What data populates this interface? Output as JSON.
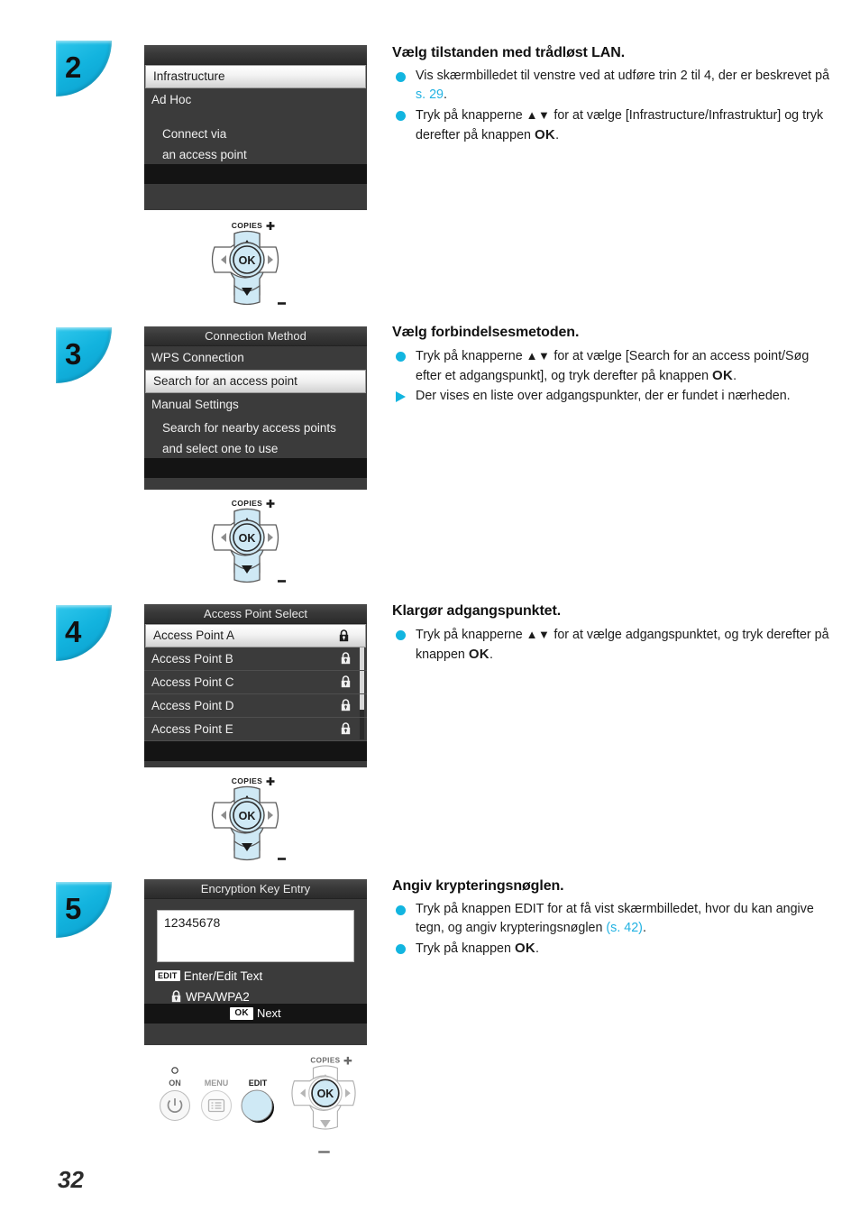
{
  "page": {
    "number": "32"
  },
  "steps": [
    {
      "badge": "2",
      "screen": {
        "title": "",
        "rows": [
          {
            "label": "Infrastructure",
            "selected": true
          },
          {
            "label": "Ad Hoc",
            "selected": false
          }
        ],
        "sublines": [
          "Connect via",
          "an access point"
        ]
      },
      "heading": "Vælg tilstanden med trådløst LAN.",
      "bullets": [
        {
          "type": "dot",
          "parts": [
            {
              "t": "Vis skærmbilledet til venstre ved at udføre trin 2 til 4, der er beskrevet på "
            },
            {
              "t": "s. 29",
              "style": "link"
            },
            {
              "t": "."
            }
          ]
        },
        {
          "type": "dot",
          "parts": [
            {
              "t": "Tryk på knapperne "
            },
            {
              "t": "▲▼",
              "style": "arrows"
            },
            {
              "t": " for at vælge [Infrastructure/Infrastruktur] og tryk derefter på knappen "
            },
            {
              "t": "OK",
              "style": "okbold"
            },
            {
              "t": "."
            }
          ]
        }
      ],
      "control": "pad"
    },
    {
      "badge": "3",
      "screen": {
        "title": "Connection Method",
        "rows": [
          {
            "label": "WPS Connection",
            "selected": false
          },
          {
            "label": "Search for an access point",
            "selected": true
          },
          {
            "label": "Manual Settings",
            "selected": false
          }
        ],
        "sublines": [
          "Search for nearby access points",
          "and select one to use"
        ]
      },
      "heading": "Vælg forbindelsesmetoden.",
      "bullets": [
        {
          "type": "dot",
          "parts": [
            {
              "t": "Tryk på knapperne "
            },
            {
              "t": "▲▼",
              "style": "arrows"
            },
            {
              "t": " for at vælge [Search for an access point/Søg efter et adgangspunkt], og tryk derefter på knappen "
            },
            {
              "t": "OK",
              "style": "okbold"
            },
            {
              "t": "."
            }
          ]
        },
        {
          "type": "tri",
          "parts": [
            {
              "t": "Der vises en liste over adgangspunkter, der er fundet i nærheden."
            }
          ]
        }
      ],
      "control": "pad"
    },
    {
      "badge": "4",
      "screen": {
        "title": "Access Point Select",
        "list": [
          {
            "label": "Access Point A",
            "selected": true,
            "lock": true
          },
          {
            "label": "Access Point B",
            "selected": false,
            "lock": true
          },
          {
            "label": "Access Point C",
            "selected": false,
            "lock": true
          },
          {
            "label": "Access Point D",
            "selected": false,
            "lock": true
          },
          {
            "label": "Access Point E",
            "selected": false,
            "lock": true
          }
        ],
        "scrollbar": true
      },
      "heading": "Klargør adgangspunktet.",
      "bullets": [
        {
          "type": "dot",
          "parts": [
            {
              "t": "Tryk på knapperne "
            },
            {
              "t": "▲▼",
              "style": "arrows"
            },
            {
              "t": " for at vælge adgangspunktet, og tryk derefter på knappen "
            },
            {
              "t": "OK",
              "style": "okbold"
            },
            {
              "t": "."
            }
          ]
        }
      ],
      "control": "pad"
    },
    {
      "badge": "5",
      "screen": {
        "title": "Encryption Key Entry",
        "key_value": "12345678",
        "edit_badge": "EDIT",
        "edit_label": "Enter/Edit Text",
        "security_label": "WPA/WPA2",
        "ok_badge": "OK",
        "foot_label": "Next"
      },
      "heading": "Angiv krypteringsnøglen.",
      "bullets": [
        {
          "type": "dot",
          "parts": [
            {
              "t": "Tryk på knappen EDIT for at få vist skærmbilledet, hvor du kan angive tegn, og angiv krypteringsnøglen "
            },
            {
              "t": "(s. 42)",
              "style": "link"
            },
            {
              "t": "."
            }
          ]
        },
        {
          "type": "dot",
          "parts": [
            {
              "t": "Tryk på knappen "
            },
            {
              "t": "OK",
              "style": "okbold"
            },
            {
              "t": "."
            }
          ]
        }
      ],
      "control": "panel"
    }
  ],
  "controls": {
    "pad": {
      "copies_label": "COPIES",
      "ok_label": "OK"
    },
    "panel": {
      "on_label": "ON",
      "menu_label": "MENU",
      "edit_label": "EDIT",
      "copies_label": "COPIES",
      "ok_label": "OK"
    }
  },
  "colors": {
    "accent": "#12b5e0",
    "link": "#22b2e2",
    "lcd_bg": "#3b3b3b",
    "highlight": "#cfe9f5"
  }
}
